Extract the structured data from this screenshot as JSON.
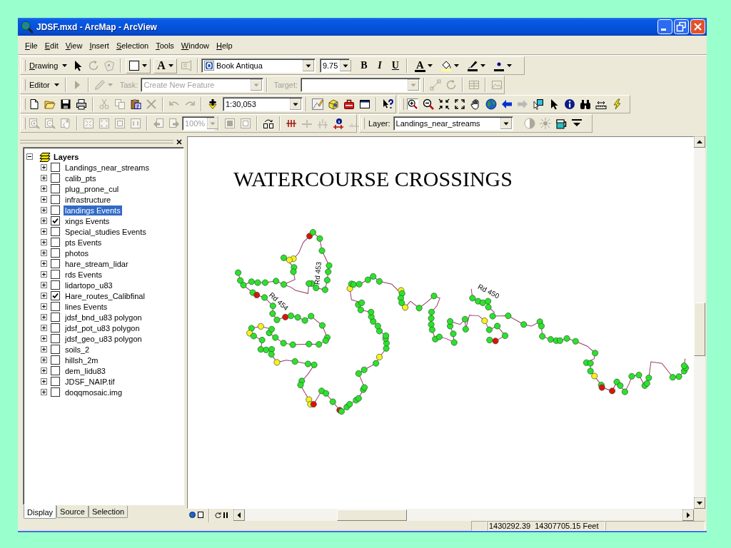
{
  "window": {
    "title": "JDSF.mxd - ArcMap - ArcView"
  },
  "menu": [
    "File",
    "Edit",
    "View",
    "Insert",
    "Selection",
    "Tools",
    "Window",
    "Help"
  ],
  "drawing_toolbar": {
    "menu": "Drawing",
    "text_tool": "A",
    "font": "Book Antiqua",
    "font_size": "9.75",
    "bold": "B",
    "italic": "I",
    "underline": "U",
    "font_color": "A"
  },
  "editor_toolbar": {
    "menu": "Editor",
    "task_label": "Task:",
    "task": "Create New Feature",
    "target_label": "Target:",
    "disabled": true
  },
  "standard_toolbar": {
    "scale": "1:30,053"
  },
  "tools_toolbar": {
    "zoom_in_selected": true
  },
  "layout_toolbar": {
    "zoom": "100%",
    "disabled": true
  },
  "effects_toolbar": {
    "layer_label": "Layer:",
    "layer": "Landings_near_streams"
  },
  "toc": {
    "root": {
      "label": "Layers",
      "expanded": true,
      "children": [
        {
          "label": "Landings_near_streams",
          "checked": false,
          "selected": false,
          "expanded": false
        },
        {
          "label": "calib_pts",
          "checked": false,
          "selected": false,
          "expanded": false
        },
        {
          "label": "plug_prone_cul",
          "checked": false,
          "selected": false,
          "expanded": false
        },
        {
          "label": "infrastructure",
          "checked": false,
          "selected": false,
          "expanded": false
        },
        {
          "label": "landings Events",
          "checked": false,
          "selected": true,
          "expanded": false
        },
        {
          "label": "xings Events",
          "checked": true,
          "selected": false,
          "expanded": false
        },
        {
          "label": "Special_studies Events",
          "checked": false,
          "selected": false,
          "expanded": false
        },
        {
          "label": "pts Events",
          "checked": false,
          "selected": false,
          "expanded": false
        },
        {
          "label": "photos",
          "checked": false,
          "selected": false,
          "expanded": false
        },
        {
          "label": "hare_stream_lidar",
          "checked": false,
          "selected": false,
          "expanded": false
        },
        {
          "label": "rds Events",
          "checked": false,
          "selected": false,
          "expanded": false
        },
        {
          "label": "lidartopo_u83",
          "checked": false,
          "selected": false,
          "expanded": false
        },
        {
          "label": "Hare_routes_Calibfinal",
          "checked": true,
          "selected": false,
          "expanded": false
        },
        {
          "label": "lines Events",
          "checked": false,
          "selected": false,
          "expanded": false
        },
        {
          "label": "jdsf_bnd_u83 polygon",
          "checked": false,
          "selected": false,
          "expanded": false
        },
        {
          "label": "jdsf_pot_u83 polygon",
          "checked": false,
          "selected": false,
          "expanded": false
        },
        {
          "label": "jdsf_geo_u83 polygon",
          "checked": false,
          "selected": false,
          "expanded": false
        },
        {
          "label": "soils_2",
          "checked": false,
          "selected": false,
          "expanded": false
        },
        {
          "label": "hillsh_2m",
          "checked": false,
          "selected": false,
          "expanded": false
        },
        {
          "label": "dem_lidu83",
          "checked": false,
          "selected": false,
          "expanded": false
        },
        {
          "label": "JDSF_NAIP.tif",
          "checked": false,
          "selected": false,
          "expanded": false
        },
        {
          "label": "doqqmosaic.img",
          "checked": false,
          "selected": false,
          "expanded": false
        }
      ]
    },
    "tabs": [
      {
        "label": "Display",
        "selected": true
      },
      {
        "label": "Source",
        "selected": false
      },
      {
        "label": "Selection",
        "selected": false
      }
    ]
  },
  "map": {
    "title": "WATERCOURSE CROSSINGS",
    "road_labels": [
      "Rd 453",
      "Rd 454",
      "Rd 450"
    ]
  },
  "status_bar": {
    "coordinates": "1430292.39  14307705.15 Feet"
  }
}
